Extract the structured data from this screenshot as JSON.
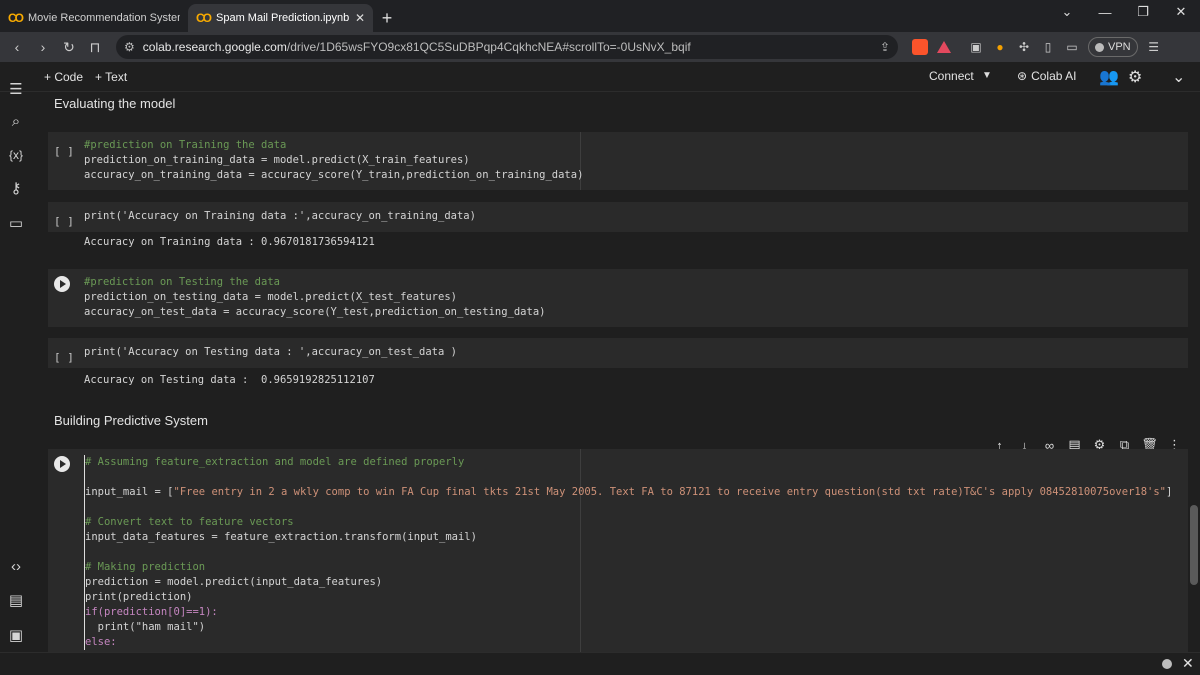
{
  "browser": {
    "tabs": [
      {
        "label": "Movie Recommendation System .ipy",
        "active": false
      },
      {
        "label": "Spam Mail Prediction.ipynb - Co",
        "active": true
      }
    ],
    "url_host": "colab.research.google.com",
    "url_path": "/drive/1D65wsFYO9cx81QC5SuDBPqp4CqkhcNEA#scrollTo=-0UsNvX_bqif",
    "vpn_label": "VPN"
  },
  "colab": {
    "add_code": "+ Code",
    "add_text": "+ Text",
    "connect": "Connect",
    "colab_ai": "Colab AI"
  },
  "sidebar": {
    "icons": [
      "table-of-contents-icon",
      "search-icon",
      "variables-icon",
      "secrets-key-icon",
      "files-folder-icon",
      "code-snippets-icon",
      "command-palette-icon",
      "terminal-icon"
    ],
    "variables_label": "{x}"
  },
  "notebook": {
    "heading_eval": "Evaluating the model",
    "heading_predict": "Building Predictive System",
    "cell1": {
      "run": "[ ]",
      "lines": [
        "#prediction on Training the data",
        "prediction_on_training_data = model.predict(X_train_features)",
        "accuracy_on_training_data = accuracy_score(Y_train,prediction_on_training_data)"
      ]
    },
    "cell2": {
      "run": "[ ]",
      "line": "print('Accuracy on Training data :',accuracy_on_training_data)",
      "output": "Accuracy on Training data : 0.9670181736594121"
    },
    "cell3": {
      "lines": [
        "#prediction on Testing the data",
        "prediction_on_testing_data = model.predict(X_test_features)",
        "accuracy_on_test_data = accuracy_score(Y_test,prediction_on_testing_data)"
      ]
    },
    "cell4": {
      "run": "[ ]",
      "line": "print('Accuracy on Testing data : ',accuracy_on_test_data )",
      "output": "Accuracy on Testing data :  0.9659192825112107"
    },
    "cell5": {
      "lines": [
        "# Assuming feature_extraction and model are defined properly",
        "",
        "input_mail = [\"Free entry in 2 a wkly comp to win FA Cup final tkts 21st May 2005. Text FA to 87121 to receive entry question(std txt rate)T&C's apply 08452810075over18's\"]",
        "",
        "# Convert text to feature vectors",
        "input_data_features = feature_extraction.transform(input_mail)",
        "",
        "# Making prediction",
        "prediction = model.predict(input_data_features)",
        "print(prediction)",
        "if(prediction[0]==1):",
        "  print(\"ham mail\")",
        "else:"
      ]
    },
    "cell_toolbar": [
      "move-up-icon",
      "move-down-icon",
      "link-icon",
      "comment-icon",
      "settings-icon",
      "mirror-cell-icon",
      "delete-icon",
      "more-icon"
    ]
  },
  "colors": {
    "background": "#1f1f1f",
    "cell": "#2a2a2a",
    "comment": "#6a9955",
    "string": "#ce9178",
    "keyword": "#c586c0",
    "colab_orange": "#f9ab00"
  }
}
